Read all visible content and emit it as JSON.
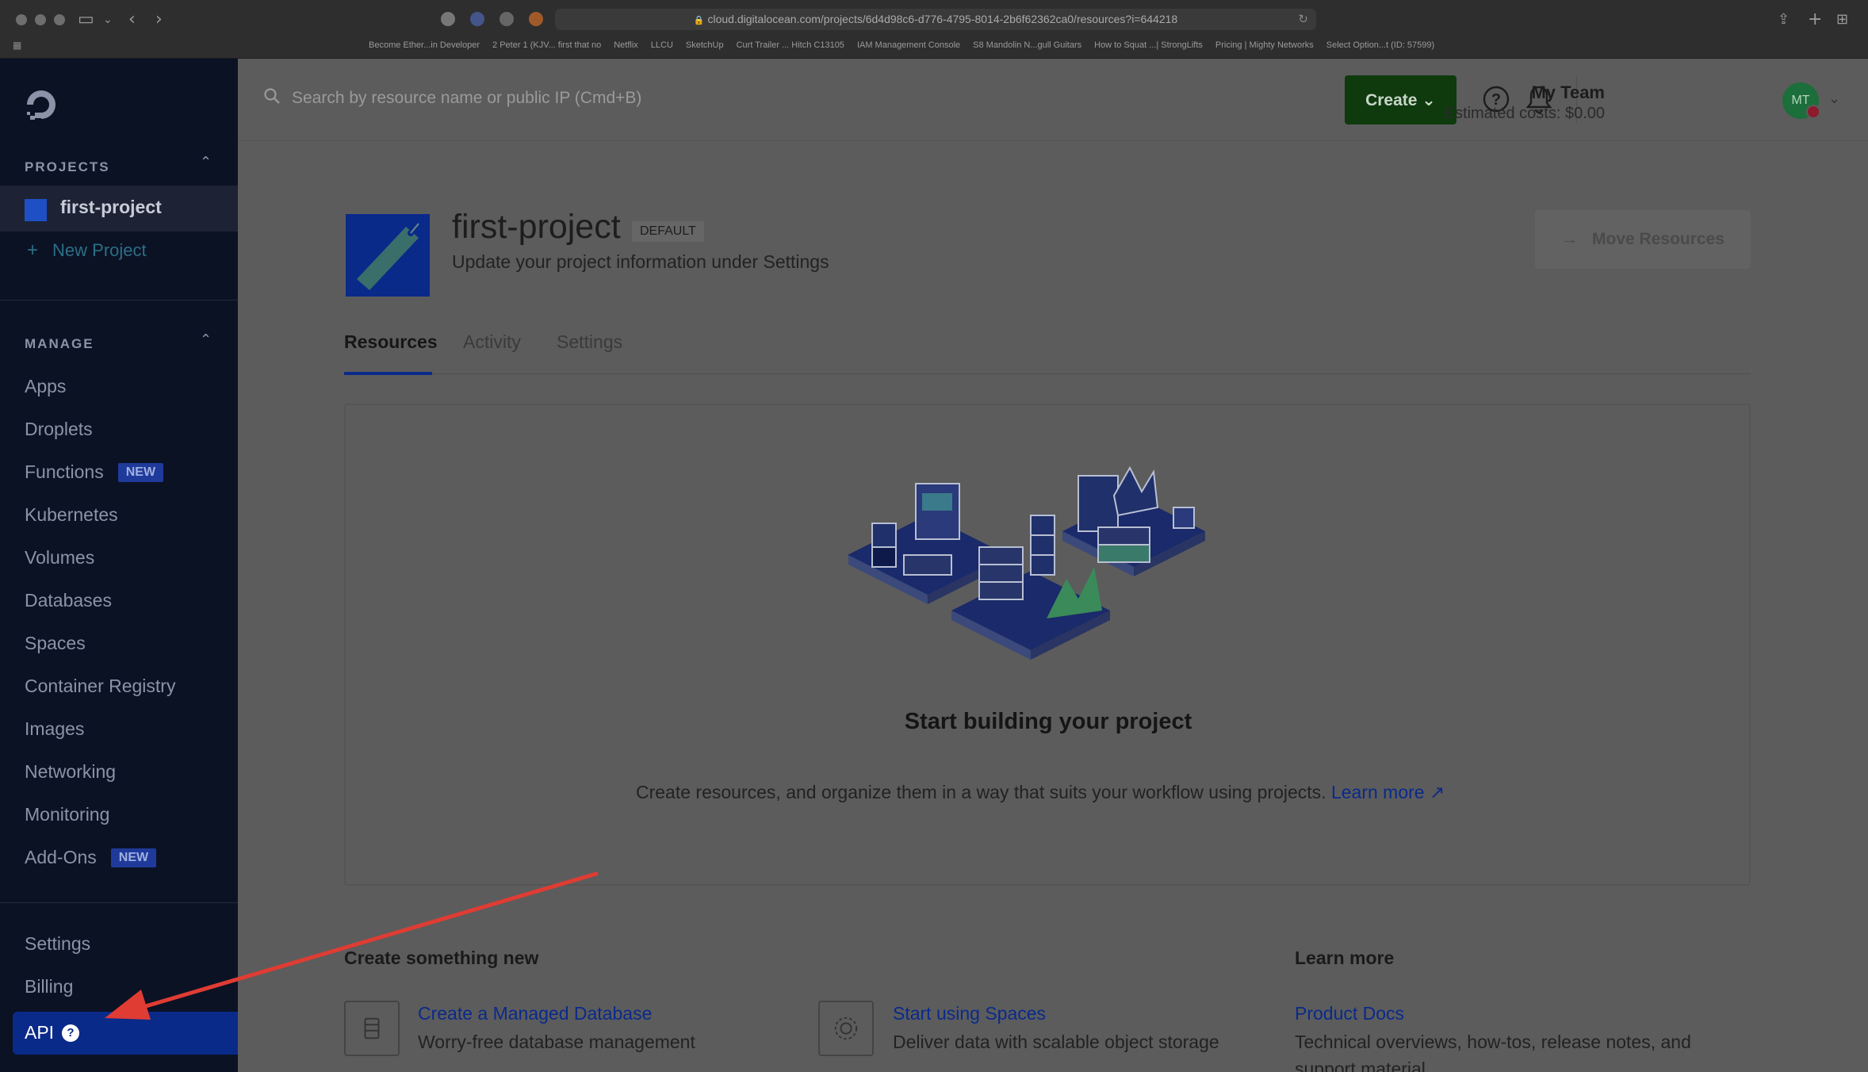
{
  "browser": {
    "url": "cloud.digitalocean.com/projects/6d4d98c6-d776-4795-8014-2b6f62362ca0/resources?i=644218",
    "bookmarks": [
      "Become Ether...in Developer",
      "2 Peter 1 (KJV... first that no",
      "Netflix",
      "LLCU",
      "SketchUp",
      "Curt Trailer ... Hitch C13105",
      "IAM Management Console",
      "S8 Mandolin N...gull Guitars",
      "How to Squat ...| StrongLifts",
      "Pricing | Mighty Networks",
      "Select Option...t (ID: 57599)"
    ]
  },
  "sidebar": {
    "projects_heading": "PROJECTS",
    "active_project": "first-project",
    "new_project": "New Project",
    "manage_heading": "MANAGE",
    "manage_items": [
      {
        "label": "Apps"
      },
      {
        "label": "Droplets"
      },
      {
        "label": "Functions",
        "badge": "NEW"
      },
      {
        "label": "Kubernetes"
      },
      {
        "label": "Volumes"
      },
      {
        "label": "Databases"
      },
      {
        "label": "Spaces"
      },
      {
        "label": "Container Registry"
      },
      {
        "label": "Images"
      },
      {
        "label": "Networking"
      },
      {
        "label": "Monitoring"
      },
      {
        "label": "Add-Ons",
        "badge": "NEW"
      }
    ],
    "footer_items": [
      {
        "label": "Settings"
      },
      {
        "label": "Billing"
      },
      {
        "label": "API"
      }
    ]
  },
  "topbar": {
    "search_placeholder": "Search by resource name or public IP (Cmd+B)",
    "create_label": "Create",
    "team_name": "My Team",
    "estimated_costs": "Estimated costs: $0.00",
    "avatar_initials": "MT"
  },
  "project": {
    "title": "first-project",
    "badge": "DEFAULT",
    "subtitle": "Update your project information under Settings",
    "move_resources": "Move Resources"
  },
  "tabs": [
    "Resources",
    "Activity",
    "Settings"
  ],
  "empty_state": {
    "title": "Start building your project",
    "description": "Create resources, and organize them in a way that suits your workflow using projects.",
    "learn_more": "Learn more ↗"
  },
  "create_section": {
    "heading": "Create something new",
    "items": [
      {
        "title": "Create a Managed Database",
        "description": "Worry-free database management"
      },
      {
        "title": "Start using Spaces",
        "description": "Deliver data with scalable object storage"
      }
    ]
  },
  "learn_section": {
    "heading": "Learn more",
    "title": "Product Docs",
    "description": "Technical overviews, how-tos, release notes, and",
    "description_line2": "support material"
  },
  "colors": {
    "sidebar_bg": "#0b1224",
    "accent_blue": "#0a2a8a",
    "create_green": "#0e3a0e",
    "annotation_red": "#e03c33"
  }
}
